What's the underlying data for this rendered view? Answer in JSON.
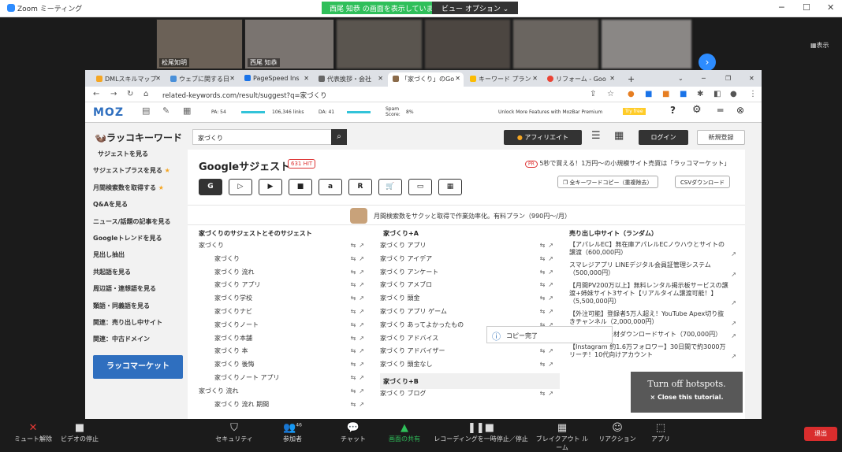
{
  "zoom": {
    "title": "Zoom ミーティング",
    "share_banner": "西尾 知恭 の画面を表示しています",
    "view_options": "ビュー オプション ⌄",
    "display_label": "▦表示",
    "participants": [
      "松尾知明",
      "西尾 知恭"
    ],
    "toolbar": {
      "mute": "ミュート解除",
      "video": "ビデオの停止",
      "security": "セキュリティ",
      "participants": "参加者",
      "participant_count": "46",
      "chat": "チャット",
      "share": "画面の共有",
      "record": "レコーディングを一時停止／停止",
      "breakout": "ブレイクアウト ルーム",
      "reactions": "リアクション",
      "apps": "アプリ",
      "leave": "退出"
    }
  },
  "browser": {
    "tabs": [
      "DMLスキルマップ",
      "ウェブに関する日",
      "PageSpeed Ins",
      "代表挨拶・会社",
      "「家づくり」のGo",
      "キーワード プラン",
      "リフォーム - Goo"
    ],
    "url": "related-keywords.com/result/suggest?q=家づくり"
  },
  "mozbar": {
    "logo": "MOZ",
    "pa": "PA: 54",
    "links": "106,346 links",
    "da": "DA: 41",
    "spam": "Spam Score:",
    "spam_val": "8%",
    "unlock": "Unlock More Features with MozBar Premium",
    "try": "Try free"
  },
  "site": {
    "brand": "ラッコキーワード",
    "search_value": "家づくり",
    "affiliate": "アフィリエイト",
    "login": "ログイン",
    "signup": "新規登録",
    "sidebar": [
      "サジェストを見る",
      "サジェストプラスを見る",
      "月間検索数を取得する",
      "Q&Aを見る",
      "ニュース/話題の記事を見る",
      "Googleトレンドを見る",
      "見出し抽出",
      "共起語を見る",
      "周辺語・連想語を見る",
      "類語・同義語を見る",
      "関連：売り出し中サイト",
      "関連：中古ドメイン"
    ],
    "sidebar_banner": "ラッコマーケット",
    "main_title": "Googleサジェスト",
    "count": "631 HIT",
    "ad_text": "5秒で買える！1万円〜の小規模サイト売買は「ラッコマーケット」",
    "ad_tag": "PR",
    "copy_all": "全キーワードコピー（重複除去）",
    "csv": "CSVダウンロード",
    "engines": [
      "G",
      "▷",
      "▶",
      "■",
      "a",
      "R",
      "🛒",
      "▭",
      "▦"
    ],
    "promo": "月間検索数をサクッと取得で作業効率化。有料プラン（990円〜/月）",
    "col1_title": "家づくりのサジェストとそのサジェスト",
    "col1": [
      "家づくり",
      "家づくり",
      "家づくり 流れ",
      "家づくり アプリ",
      "家づくり学校",
      "家づくりナビ",
      "家づくりノート",
      "家づくり本舗",
      "家づくり 本",
      "家づくり 後悔",
      "家づくりノート アプリ",
      "家づくり 流れ",
      "家づくり 流れ 期間"
    ],
    "col2_title": "家づくり+A",
    "col2": [
      "家づくり アプリ",
      "家づくり アイデア",
      "家づくり アンケート",
      "家づくり アメブロ",
      "家づくり 頭金",
      "家づくり アプリ ゲーム",
      "家づくり あってよかったもの",
      "家づくり アドバイス",
      "家づくり アドバイザー",
      "家づくり 頭金なし"
    ],
    "col2_sub": "家づくり+B",
    "col2b": [
      "家づくり ブログ"
    ],
    "col3_title": "売り出し中サイト（ランダム）",
    "col3": [
      "【アパレルEC】無在庫アパレルECノウハウとサイトの譲渡（600,000円）",
      "スマレジアプリ LINEデジタル会員証管理システム（500,000円）",
      "【月間PV200万以上】無料レンタル掲示板サービスの譲渡+姉妹サイト3サイト【リアルタイム譲渡可能！】（5,500,000円）",
      "【外注可能】登録者5万人超え！YouTube Apex切り抜きチャンネル（2,000,000円）",
      "教員向け教育素材ダウンロードサイト（700,000円）",
      "【Instagram 約1.6万フォロワー】30日間で約3000万リーチ！10代向けアカウント"
    ],
    "toast": "コピー完了",
    "hotspot_1": "Turn off hotspots.",
    "hotspot_2": "× Close this tutorial."
  }
}
